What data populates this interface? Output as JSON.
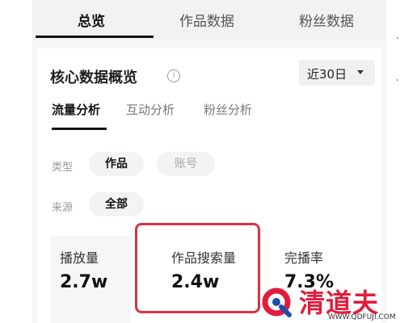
{
  "top_tabs": [
    {
      "label": "总览",
      "active": true
    },
    {
      "label": "作品数据",
      "active": false
    },
    {
      "label": "粉丝数据",
      "active": false
    }
  ],
  "card": {
    "title": "核心数据概览",
    "info_icon": "info-icon",
    "date_range": "近30日"
  },
  "sub_tabs": [
    {
      "label": "流量分析",
      "active": true
    },
    {
      "label": "互动分析",
      "active": false
    },
    {
      "label": "粉丝分析",
      "active": false
    }
  ],
  "filters": {
    "type_label": "类型",
    "type_options": [
      "作品",
      "账号"
    ],
    "type_selected": "作品",
    "source_label": "来源",
    "source_options": [
      "全部"
    ],
    "source_selected": "全部"
  },
  "metrics": [
    {
      "label": "播放量",
      "value": "2.7w"
    },
    {
      "label": "作品搜索量",
      "value": "2.4w",
      "highlighted": true
    },
    {
      "label": "完播率",
      "value": "7.3%"
    }
  ],
  "colors": {
    "highlight_border": "#d9333f",
    "watermark_red": "#e31b3b"
  },
  "watermark": {
    "text": "清道夫",
    "url": "WWW.QDFUJI.COM"
  }
}
